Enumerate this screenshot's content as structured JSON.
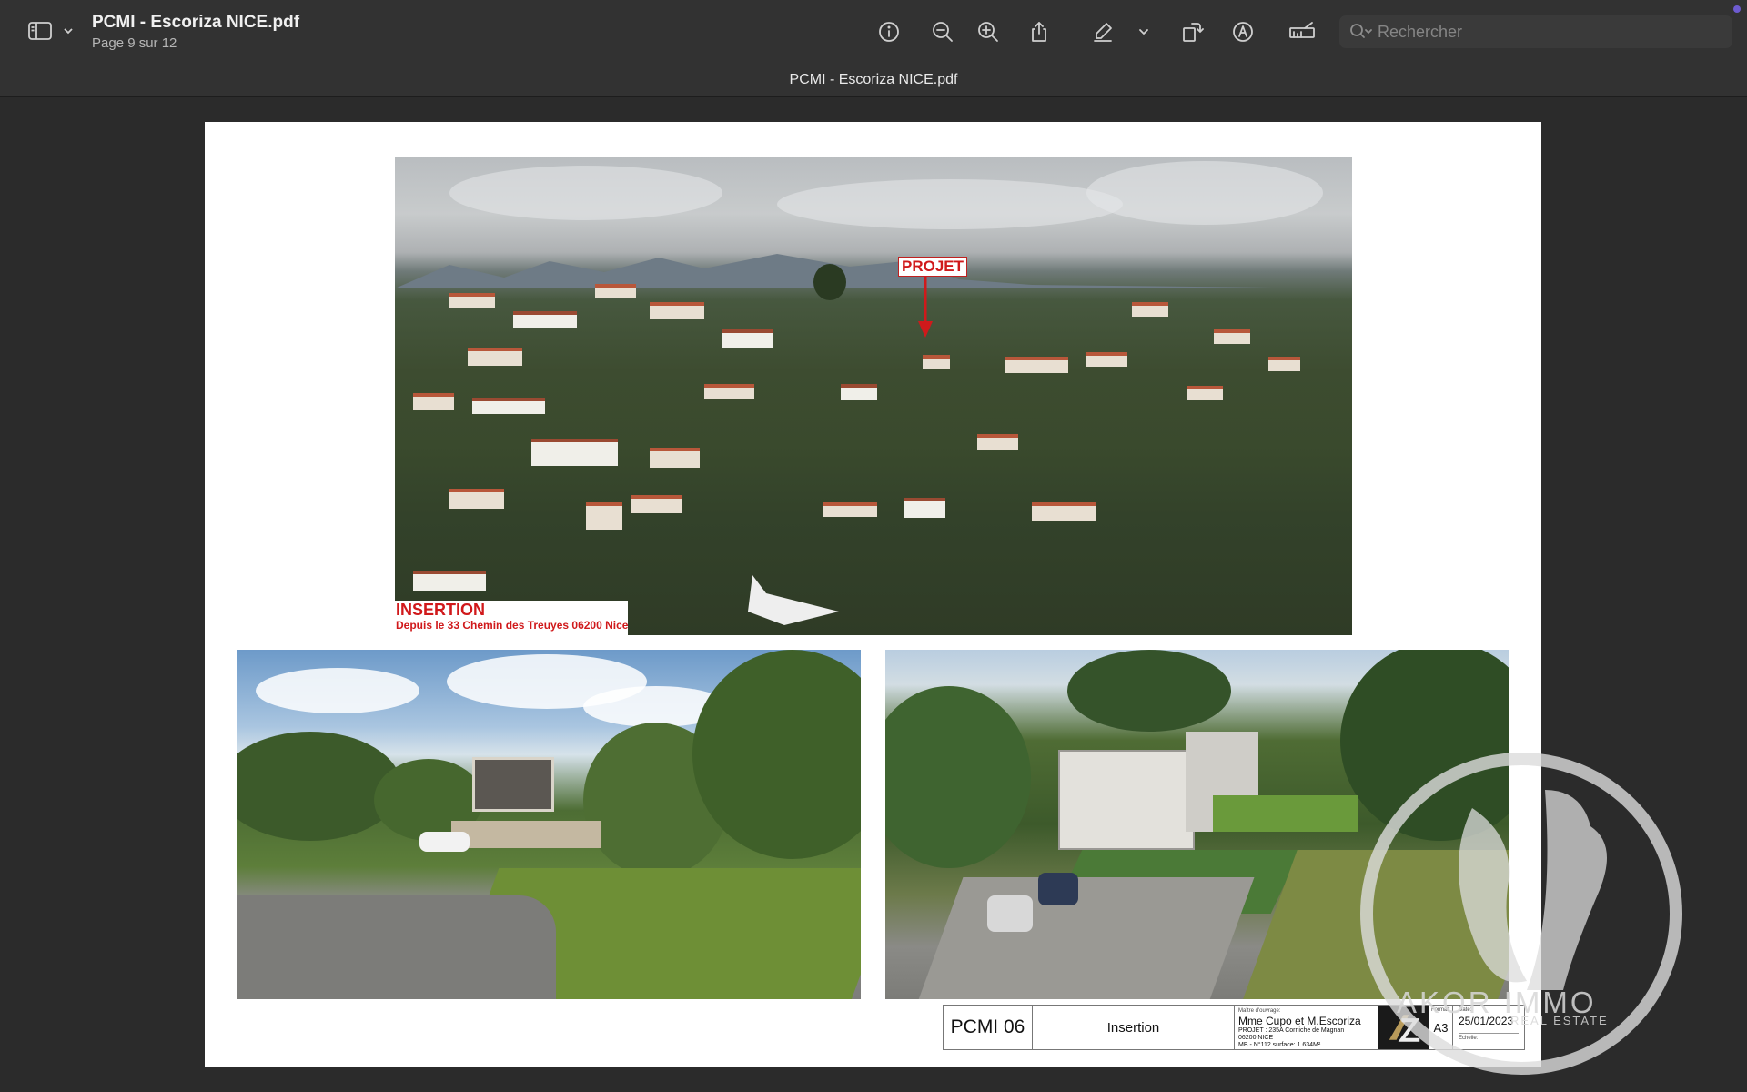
{
  "window": {
    "doc_title": "PCMI - Escoriza NICE.pdf",
    "page_indicator": "Page 9 sur 12",
    "tab_title": "PCMI - Escoriza NICE.pdf"
  },
  "toolbar": {
    "icons": [
      "sidebar-icon",
      "chevron-down-icon",
      "info-icon",
      "zoom-out-icon",
      "zoom-in-icon",
      "share-icon",
      "highlight-pen-icon",
      "chevron-down-icon",
      "rotate-icon",
      "markup-icon",
      "redact-icon",
      "search-icon"
    ],
    "search_placeholder": "Rechercher"
  },
  "document": {
    "main_photo": {
      "projet_label": "PROJET",
      "insertion_title": "INSERTION",
      "insertion_subtitle": "Depuis le 33 Chemin des Treuyes 06200 Nice"
    },
    "title_block": {
      "code": "PCMI 06",
      "name": "Insertion",
      "owner_label": "Maître d'ouvrage:",
      "owner": "Mme Cupo et M.Escoriza",
      "project_line": "PROJET : 235A Corniche de Magnan",
      "city_line": "06200 NICE",
      "parcel_line": "MB - N°112 surface: 1 634M²",
      "format_label": "Format:",
      "format": "A3",
      "date_label": "Date:",
      "date": "25/01/2023",
      "scale_label": "Echelle:"
    },
    "watermark": {
      "brand": "AKOR IMMO",
      "tagline": "REAL ESTATE"
    }
  },
  "colors": {
    "accent_red": "#d0191b",
    "toolbar_bg": "#323232",
    "canvas_bg": "#2b2b2b"
  }
}
